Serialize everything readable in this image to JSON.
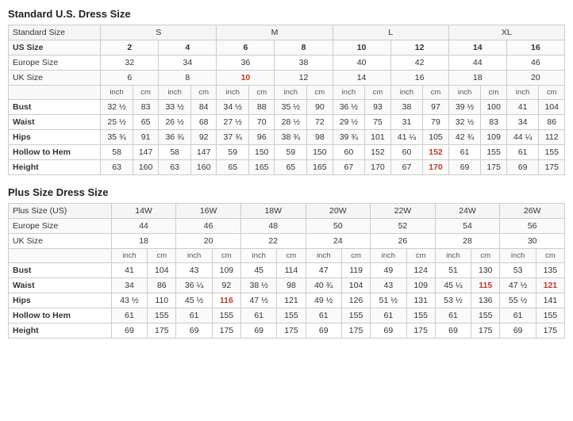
{
  "standard": {
    "title": "Standard U.S. Dress Size",
    "size_groups": [
      {
        "label": "Standard Size",
        "cols": [
          "S",
          "",
          "M",
          "",
          "L",
          "",
          "XL",
          ""
        ]
      },
      {
        "label": "US Size",
        "cols": [
          "2",
          "4",
          "6",
          "8",
          "10",
          "12",
          "14",
          "16"
        ]
      },
      {
        "label": "Europe Size",
        "cols": [
          "32",
          "34",
          "36",
          "38",
          "40",
          "42",
          "44",
          "46"
        ]
      },
      {
        "label": "UK Size",
        "cols": [
          "6",
          "8",
          "10",
          "12",
          "14",
          "16",
          "18",
          "20"
        ]
      }
    ],
    "unit_row": [
      "inch",
      "cm",
      "inch",
      "cm",
      "inch",
      "cm",
      "inch",
      "cm",
      "inch",
      "cm",
      "inch",
      "cm",
      "inch",
      "cm",
      "inch",
      "cm"
    ],
    "measurements": [
      {
        "label": "Bust",
        "cols": [
          "32 ½",
          "83",
          "33 ½",
          "84",
          "34 ½",
          "88",
          "35 ½",
          "90",
          "36 ½",
          "93",
          "38",
          "97",
          "39 ½",
          "100",
          "41",
          "104"
        ]
      },
      {
        "label": "Waist",
        "cols": [
          "25 ½",
          "65",
          "26 ½",
          "68",
          "27 ½",
          "70",
          "28 ½",
          "72",
          "29 ½",
          "75",
          "31",
          "79",
          "32 ½",
          "83",
          "34",
          "86"
        ]
      },
      {
        "label": "Hips",
        "cols": [
          "35 ¾",
          "91",
          "36 ¾",
          "92",
          "37 ¾",
          "96",
          "38 ¾",
          "98",
          "39 ¾",
          "101",
          "41 ¼",
          "105",
          "42 ¾",
          "109",
          "44 ¼",
          "112"
        ]
      },
      {
        "label": "Hollow to Hem",
        "cols": [
          "58",
          "147",
          "58",
          "147",
          "59",
          "150",
          "59",
          "150",
          "60",
          "152",
          "60",
          "152",
          "61",
          "155",
          "61",
          "155"
        ]
      },
      {
        "label": "Height",
        "cols": [
          "63",
          "160",
          "63",
          "160",
          "65",
          "165",
          "65",
          "165",
          "67",
          "170",
          "67",
          "170",
          "69",
          "175",
          "69",
          "175"
        ]
      }
    ],
    "uk_highlights": [
      2
    ],
    "hollow_highlights": [
      5,
      11
    ],
    "height_highlights": [
      5,
      11
    ]
  },
  "plus": {
    "title": "Plus Size Dress Size",
    "size_groups": [
      {
        "label": "Plus Size (US)",
        "cols": [
          "14W",
          "16W",
          "18W",
          "20W",
          "22W",
          "24W",
          "26W"
        ]
      },
      {
        "label": "Europe Size",
        "cols": [
          "44",
          "46",
          "48",
          "50",
          "52",
          "54",
          "56"
        ]
      },
      {
        "label": "UK Size",
        "cols": [
          "18",
          "20",
          "22",
          "24",
          "26",
          "28",
          "30"
        ]
      }
    ],
    "unit_row": [
      "inch",
      "cm",
      "inch",
      "cm",
      "inch",
      "cm",
      "inch",
      "cm",
      "inch",
      "cm",
      "inch",
      "cm",
      "inch",
      "cm"
    ],
    "measurements": [
      {
        "label": "Bust",
        "cols": [
          "41",
          "104",
          "43",
          "109",
          "45",
          "114",
          "47",
          "119",
          "49",
          "124",
          "51",
          "130",
          "53",
          "135"
        ]
      },
      {
        "label": "Waist",
        "cols": [
          "34",
          "86",
          "36 ¼",
          "92",
          "38 ½",
          "98",
          "40 ¾",
          "104",
          "43",
          "109",
          "45 ¼",
          "115",
          "47 ½",
          "121"
        ]
      },
      {
        "label": "Hips",
        "cols": [
          "43 ½",
          "110",
          "45 ½",
          "116",
          "47 ½",
          "121",
          "49 ½",
          "126",
          "51 ½",
          "131",
          "53 ½",
          "136",
          "55 ½",
          "141"
        ]
      },
      {
        "label": "Hollow to Hem",
        "cols": [
          "61",
          "155",
          "61",
          "155",
          "61",
          "155",
          "61",
          "155",
          "61",
          "155",
          "61",
          "155",
          "61",
          "155"
        ]
      },
      {
        "label": "Height",
        "cols": [
          "69",
          "175",
          "69",
          "175",
          "69",
          "175",
          "69",
          "175",
          "69",
          "175",
          "69",
          "175",
          "69",
          "175"
        ]
      }
    ],
    "waist_highlights": [
      5,
      11
    ],
    "hips_highlights": [
      1,
      3,
      11
    ]
  }
}
